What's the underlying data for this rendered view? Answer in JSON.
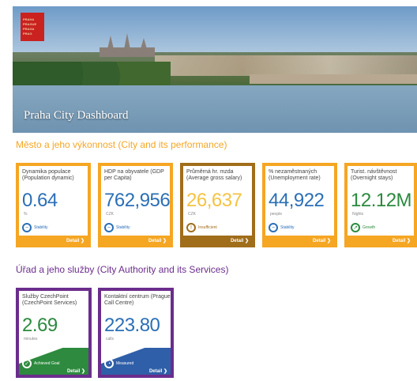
{
  "logo": {
    "lines": [
      "PRAHA",
      "PRAGUE",
      "PRAGA",
      "PRAG"
    ]
  },
  "header": {
    "title": "Praha City Dashboard"
  },
  "sections": {
    "performance": "Město a jeho výkonnost (City and its performance)",
    "authority": "Úřad a jeho služby (City Authority and its Services)"
  },
  "performance_cards": [
    {
      "label": "Dynamika populace (Population dynamic)",
      "value": "0.64",
      "unit": "%",
      "status": "Stability",
      "detail": "Detail"
    },
    {
      "label": "HDP na obyvatele (GDP per Capita)",
      "value": "762,956",
      "unit": "CZK",
      "status": "Stability",
      "detail": "Detail"
    },
    {
      "label": "Průměrná hr. mzda (Average gross salary)",
      "value": "26,637",
      "unit": "CZK",
      "status": "Insufficient",
      "detail": "Detail"
    },
    {
      "label": "% nezaměstnaných (Unemployment rate)",
      "value": "44,922",
      "unit": "people",
      "status": "Stability",
      "detail": "Detail"
    },
    {
      "label": "Turist. návštěvnost (Overnight stays)",
      "value": "12.12M",
      "unit": "Nights",
      "status": "Growth",
      "detail": "Detail"
    }
  ],
  "authority_cards": [
    {
      "label": "Služby CzechPoint (CzechPoint Services)",
      "value": "2.69",
      "unit": "minutes",
      "status": "Achieved Goal",
      "detail": "Detail"
    },
    {
      "label": "Kontaktní centrum (Prague Call Centre)",
      "value": "223.80",
      "unit": "calls",
      "status": "Measured",
      "detail": "Detail"
    }
  ],
  "colors": {
    "performance_accent": "#f5a623",
    "authority_accent": "#6b2d8c",
    "value_blue": "#2b6fb6"
  }
}
